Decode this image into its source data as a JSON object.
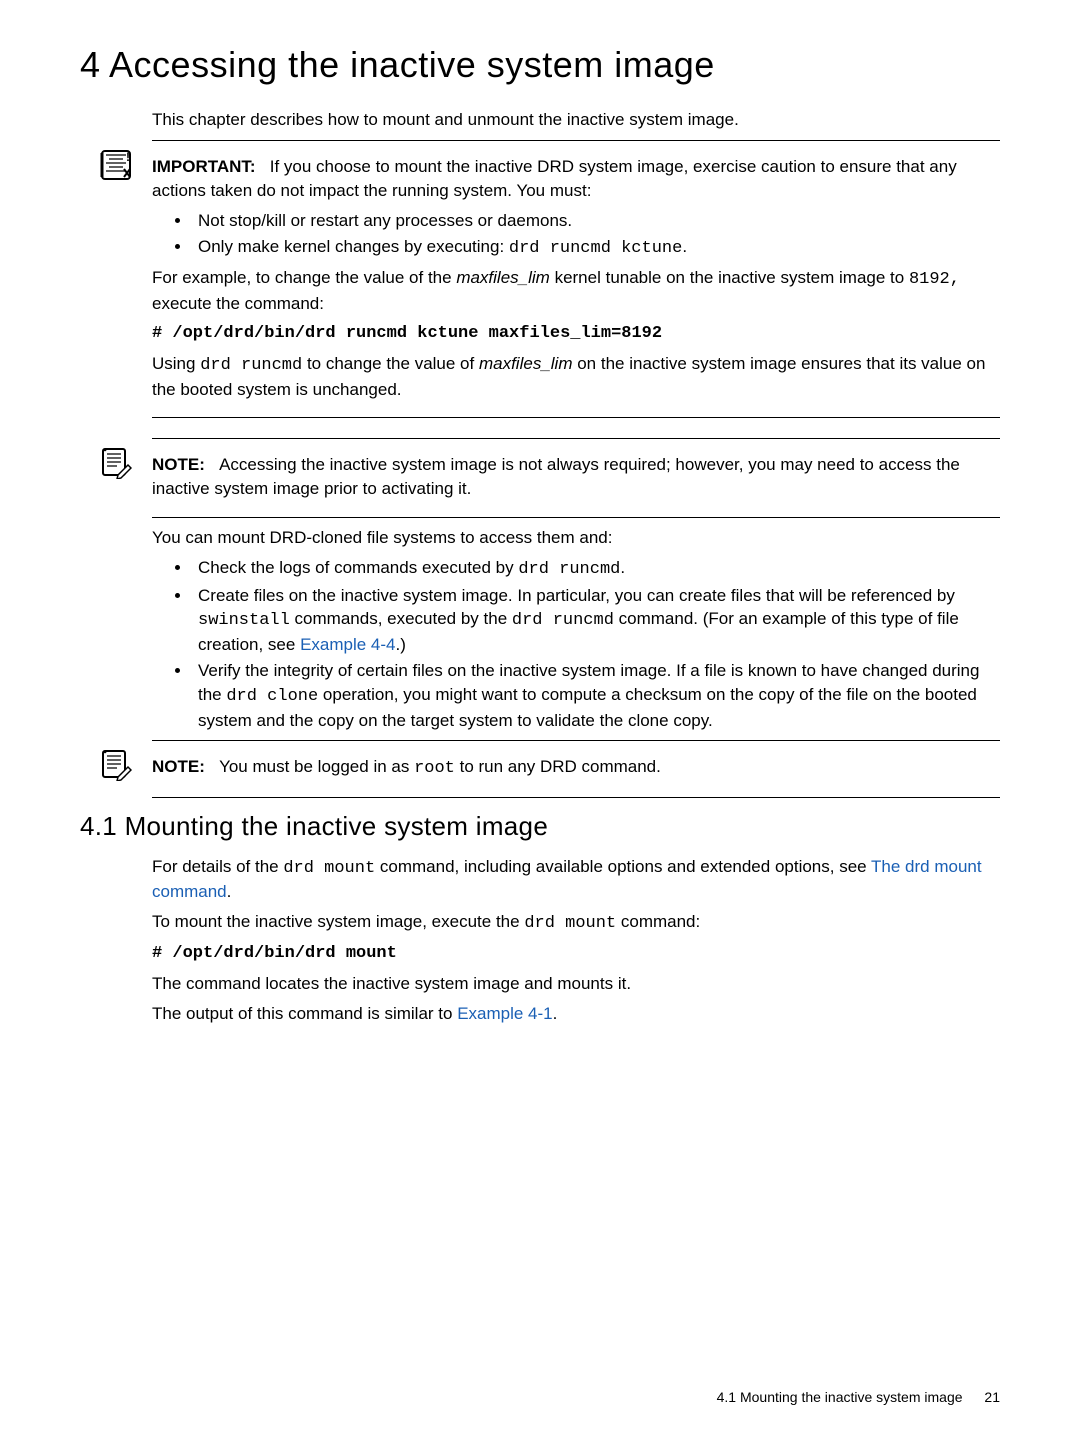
{
  "chapter": {
    "title": "4 Accessing the inactive system image",
    "intro": "This chapter describes how to mount and unmount the inactive system image."
  },
  "important": {
    "label": "IMPORTANT:",
    "lead1": "If you choose to mount the inactive DRD system image, exercise caution to ensure that any actions taken do not impact the running system. You must:",
    "bullets": {
      "b1": "Not stop/kill or restart any processes or daemons.",
      "b2a": "Only make kernel changes by executing: ",
      "b2b": "drd runcmd kctune",
      "b2c": "."
    },
    "p2a": "For example, to change the value of the ",
    "p2b": "maxfiles_lim",
    "p2c": " kernel tunable on the inactive system image to ",
    "p2d": "8192,",
    "p2e": " execute the command:",
    "cmd": "# /opt/drd/bin/drd runcmd kctune maxfiles_lim=8192",
    "p3a": "Using ",
    "p3b": "drd runcmd",
    "p3c": " to change the value of ",
    "p3d": "maxfiles_lim",
    "p3e": " on the inactive system image ensures that its value on the booted system is unchanged."
  },
  "note1": {
    "label": "NOTE:",
    "text": "Accessing the inactive system image is not always required; however, you may need to access the inactive system image prior to activating it."
  },
  "mountlist": {
    "intro": "You can mount DRD-cloned file systems to access them and:",
    "b1a": "Check the logs of commands executed by ",
    "b1b": "drd runcmd",
    "b1c": ".",
    "b2a": "Create files on the inactive system image. In particular, you can create files that will be referenced by ",
    "b2b": "swinstall",
    "b2c": " commands, executed by the ",
    "b2d": "drd runcmd",
    "b2e": " command. (For an example of this type of file creation, see ",
    "b2f": "Example 4-4",
    "b2g": ".)",
    "b3a": "Verify the integrity of certain files on the inactive system image. If a file is known to have changed during the ",
    "b3b": "drd clone",
    "b3c": " operation, you might want to compute a checksum on the copy of the file on the booted system and the copy on the target system to validate the clone copy."
  },
  "note2": {
    "label": "NOTE:",
    "t1": "You must be logged in as ",
    "t2": "root",
    "t3": " to run any DRD command."
  },
  "section41": {
    "heading": "4.1 Mounting the inactive system image",
    "p1a": "For details of the ",
    "p1b": "drd mount",
    "p1c": " command, including available options and extended options, see ",
    "p1d": "The drd mount command",
    "p1e": ".",
    "p2a": "To mount the inactive system image, execute the ",
    "p2b": "drd mount",
    "p2c": " command:",
    "cmd": "# /opt/drd/bin/drd mount",
    "p3": "The command locates the inactive system image and mounts it.",
    "p4a": "The output of this command is similar to ",
    "p4b": "Example 4-1",
    "p4c": "."
  },
  "footer": {
    "text": "4.1 Mounting the inactive system image",
    "page": "21"
  }
}
